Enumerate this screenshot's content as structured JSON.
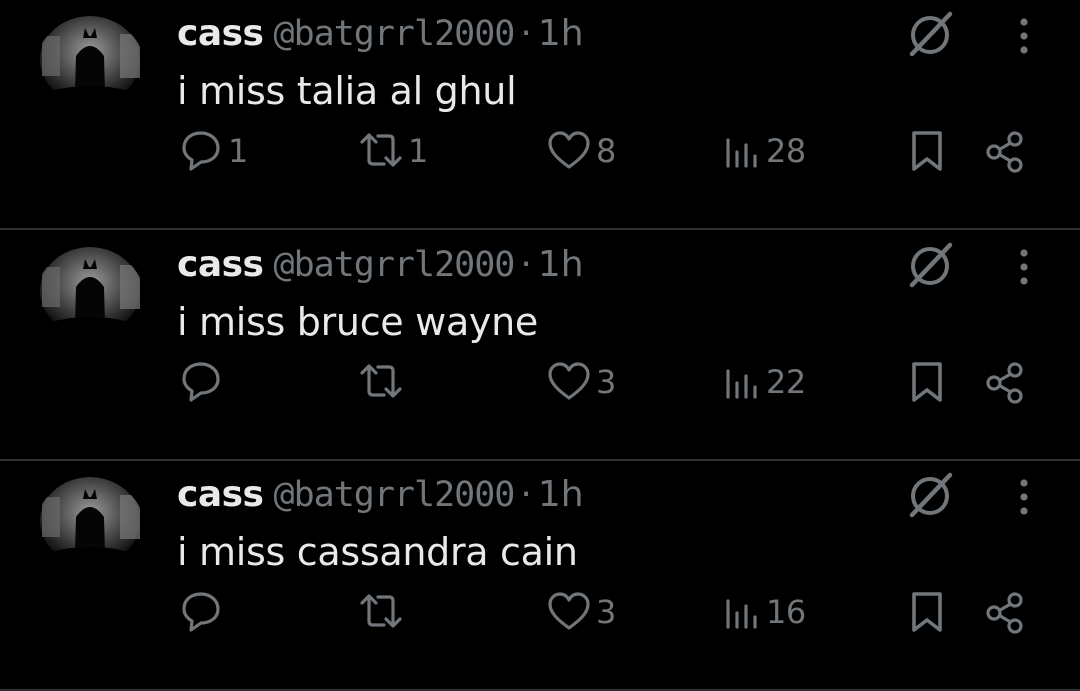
{
  "colors": {
    "background": "#000000",
    "text_primary": "#e7e9ea",
    "text_secondary": "#71767b",
    "divider": "#2f3336"
  },
  "icons": {
    "grok": "grok-slash-circle-icon",
    "more": "vertical-ellipsis-icon",
    "reply": "speech-bubble-icon",
    "retweet": "retweet-arrows-icon",
    "like": "heart-outline-icon",
    "views": "bar-chart-icon",
    "bookmark": "bookmark-icon",
    "share": "share-nodes-icon"
  },
  "tweets": [
    {
      "display_name": "cass",
      "handle": "@batgrrl2000",
      "separator": "·",
      "time": "1h",
      "text": "i miss talia al ghul",
      "replies": "1",
      "retweets": "1",
      "likes": "8",
      "views": "28"
    },
    {
      "display_name": "cass",
      "handle": "@batgrrl2000",
      "separator": "·",
      "time": "1h",
      "text": "i miss bruce wayne",
      "replies": "",
      "retweets": "",
      "likes": "3",
      "views": "22"
    },
    {
      "display_name": "cass",
      "handle": "@batgrrl2000",
      "separator": "·",
      "time": "1h",
      "text": "i miss cassandra cain",
      "replies": "",
      "retweets": "",
      "likes": "3",
      "views": "16"
    }
  ]
}
